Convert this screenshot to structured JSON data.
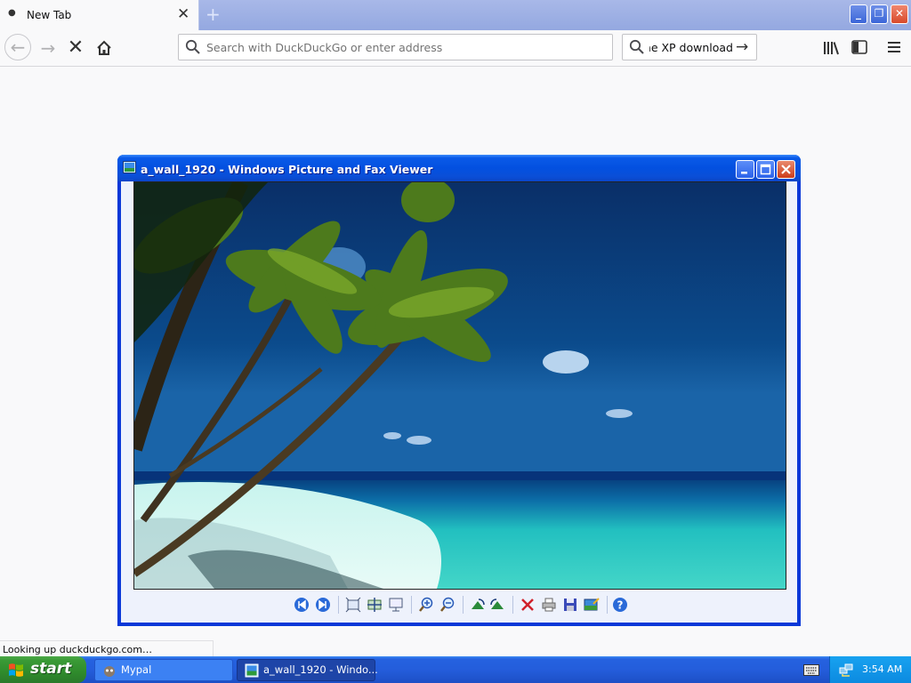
{
  "browser": {
    "tab": {
      "title": "New Tab"
    },
    "newtab_label": "+",
    "urlbar": {
      "placeholder": "Search with DuckDuckGo or enter address",
      "value": ""
    },
    "searchbar": {
      "value": "ne XP download"
    },
    "status": "Looking up duckduckgo.com…"
  },
  "viewer": {
    "title": "a_wall_1920 - Windows Picture and Fax Viewer",
    "image": "tropical beach with palm trees",
    "toolbar": [
      "previous-image",
      "next-image",
      "best-fit",
      "actual-size",
      "slideshow",
      "zoom-in",
      "zoom-out",
      "rotate-clockwise",
      "rotate-counterclockwise",
      "delete",
      "print",
      "save",
      "open-for-editing",
      "help"
    ]
  },
  "taskbar": {
    "start_label": "start",
    "tasks": [
      {
        "label": "Mypal"
      },
      {
        "label": "a_wall_1920 - Windo..."
      }
    ],
    "clock": "3:54 AM"
  },
  "colors": {
    "xp_blue": "#0a38d8",
    "start_green": "#3a9a36",
    "tray_blue": "#18a2f0",
    "sky": "#0a3f7e",
    "sea": "#2bc8c0"
  }
}
